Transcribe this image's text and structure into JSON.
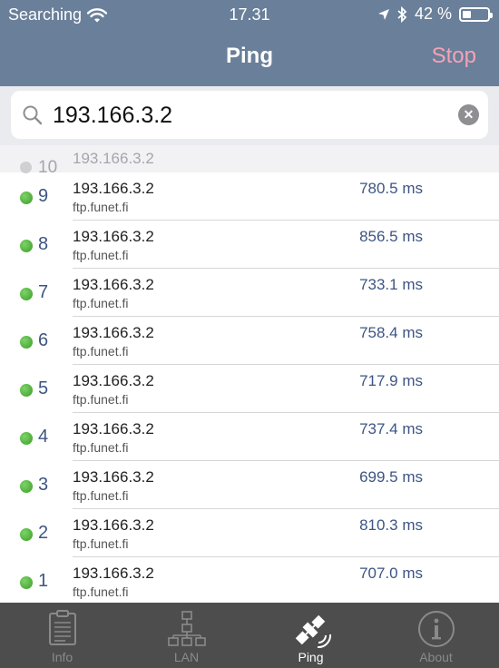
{
  "status_bar": {
    "carrier": "Searching",
    "time": "17.31",
    "battery": "42 %",
    "battery_level": 0.42
  },
  "nav": {
    "title": "Ping",
    "stop_label": "Stop"
  },
  "search": {
    "value": "193.166.3.2"
  },
  "pending": {
    "num": "10",
    "ip": "193.166.3.2"
  },
  "rows": [
    {
      "num": "9",
      "ip": "193.166.3.2",
      "host": "ftp.funet.fi",
      "ms": "780.5 ms"
    },
    {
      "num": "8",
      "ip": "193.166.3.2",
      "host": "ftp.funet.fi",
      "ms": "856.5 ms"
    },
    {
      "num": "7",
      "ip": "193.166.3.2",
      "host": "ftp.funet.fi",
      "ms": "733.1 ms"
    },
    {
      "num": "6",
      "ip": "193.166.3.2",
      "host": "ftp.funet.fi",
      "ms": "758.4 ms"
    },
    {
      "num": "5",
      "ip": "193.166.3.2",
      "host": "ftp.funet.fi",
      "ms": "717.9 ms"
    },
    {
      "num": "4",
      "ip": "193.166.3.2",
      "host": "ftp.funet.fi",
      "ms": "737.4 ms"
    },
    {
      "num": "3",
      "ip": "193.166.3.2",
      "host": "ftp.funet.fi",
      "ms": "699.5 ms"
    },
    {
      "num": "2",
      "ip": "193.166.3.2",
      "host": "ftp.funet.fi",
      "ms": "810.3 ms"
    },
    {
      "num": "1",
      "ip": "193.166.3.2",
      "host": "ftp.funet.fi",
      "ms": "707.0 ms"
    }
  ],
  "tabs": [
    {
      "label": "Info",
      "icon": "clipboard-icon",
      "active": false
    },
    {
      "label": "LAN",
      "icon": "network-icon",
      "active": false
    },
    {
      "label": "Ping",
      "icon": "satellite-icon",
      "active": true
    },
    {
      "label": "About",
      "icon": "info-icon",
      "active": false
    }
  ],
  "colors": {
    "nav_bar": "#6a7f99",
    "stop": "#f4a3b6",
    "accent_text": "#3d5583",
    "status_dot": "#4caf36",
    "tab_bar": "#4d4d4d"
  }
}
